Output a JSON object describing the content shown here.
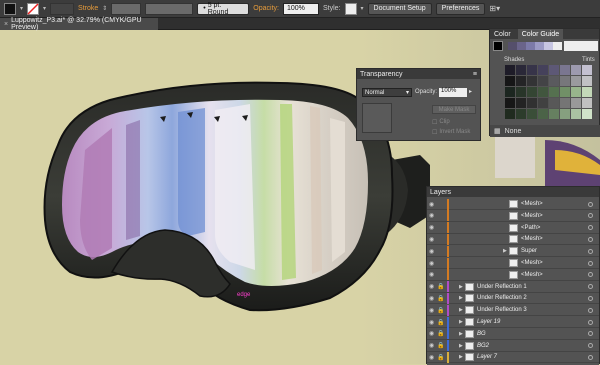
{
  "control_bar": {
    "stroke_label": "Stroke",
    "brush_label": "5 pt. Round",
    "opacity_label": "Opacity:",
    "opacity_value": "100%",
    "style_label": "Style:",
    "document_setup_label": "Document Setup",
    "preferences_label": "Preferences"
  },
  "document_tab": {
    "title": "Luppowitz_P3.ai* @ 32.79% (CMYK/GPU Preview)"
  },
  "canvas": {
    "edge_label": "edge"
  },
  "transparency_panel": {
    "title": "Transparency",
    "blend_mode": "Normal",
    "opacity_label": "Opacity:",
    "opacity_value": "100%",
    "make_mask_label": "Make Mask",
    "clip_label": "Clip",
    "invert_mask_label": "Invert Mask"
  },
  "color_panel": {
    "tabs": [
      "Color",
      "Color Guide"
    ],
    "shades_label": "Shades",
    "tints_label": "Tints",
    "none_label": "None"
  },
  "layers_panel": {
    "title": "Layers",
    "rows": [
      {
        "label": "<Mesh>",
        "color": "#d47b22"
      },
      {
        "label": "<Mesh>",
        "color": "#d47b22"
      },
      {
        "label": "<Path>",
        "color": "#d47b22"
      },
      {
        "label": "<Mesh>",
        "color": "#d47b22"
      },
      {
        "label": "Super",
        "color": "#d47b22"
      },
      {
        "label": "<Mesh>",
        "color": "#d47b22"
      },
      {
        "label": "<Mesh>",
        "color": "#d47b22"
      },
      {
        "label": "Under Reflection 1",
        "color": "#b04cc8"
      },
      {
        "label": "Under Reflection 2",
        "color": "#b04cc8"
      },
      {
        "label": "Under Reflection 3",
        "color": "#b04cc8"
      },
      {
        "label": "Layer 19",
        "color": "#3d6ad8"
      },
      {
        "label": "BG",
        "color": "#3d6ad8"
      },
      {
        "label": "BG2",
        "color": "#3d6ad8"
      },
      {
        "label": "Layer 7",
        "color": "#d8b03d"
      }
    ]
  }
}
